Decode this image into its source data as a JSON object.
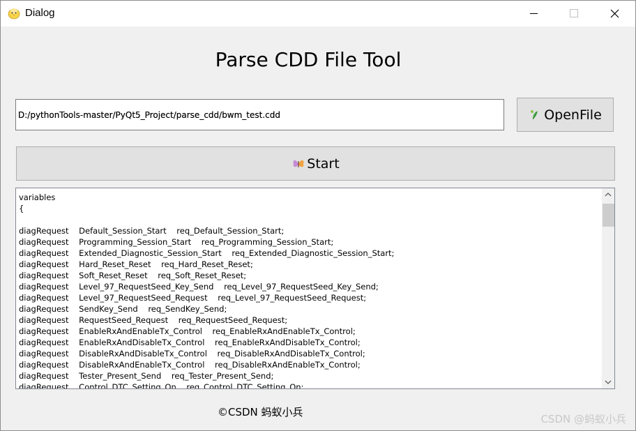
{
  "window": {
    "title": "Dialog",
    "controls": [
      "minimize-icon",
      "maximize-icon",
      "close-icon"
    ]
  },
  "main": {
    "heading": "Parse CDD File Tool",
    "path_value": "D:/pythonTools-master/PyQt5_Project/parse_cdd/bwm_test.cdd",
    "open_button_label": "OpenFile",
    "start_button_label": "Start",
    "output_lines": [
      "variables",
      "{",
      "",
      "diagRequest    Default_Session_Start    req_Default_Session_Start;",
      "diagRequest    Programming_Session_Start    req_Programming_Session_Start;",
      "diagRequest    Extended_Diagnostic_Session_Start    req_Extended_Diagnostic_Session_Start;",
      "diagRequest    Hard_Reset_Reset    req_Hard_Reset_Reset;",
      "diagRequest    Soft_Reset_Reset    req_Soft_Reset_Reset;",
      "diagRequest    Level_97_RequestSeed_Key_Send    req_Level_97_RequestSeed_Key_Send;",
      "diagRequest    Level_97_RequestSeed_Request    req_Level_97_RequestSeed_Request;",
      "diagRequest    SendKey_Send    req_SendKey_Send;",
      "diagRequest    RequestSeed_Request    req_RequestSeed_Request;",
      "diagRequest    EnableRxAndEnableTx_Control    req_EnableRxAndEnableTx_Control;",
      "diagRequest    EnableRxAndDisableTx_Control    req_EnableRxAndDisableTx_Control;",
      "diagRequest    DisableRxAndDisableTx_Control    req_DisableRxAndDisableTx_Control;",
      "diagRequest    DisableRxAndEnableTx_Control    req_DisableRxAndEnableTx_Control;",
      "diagRequest    Tester_Present_Send    req_Tester_Present_Send;",
      "diagRequest    Control_DTC_Setting_On    req_Control_DTC_Setting_On;"
    ]
  },
  "footer": {
    "credit": "©CSDN 蚂蚁小兵",
    "watermark": "CSDN @蚂蚁小兵"
  },
  "icons": {
    "app": "chick-icon",
    "open": "leaf-icon",
    "start": "butterfly-icon",
    "scroll_up": "chevron-up-icon",
    "scroll_down": "chevron-down-icon"
  },
  "colors": {
    "window_bg": "#f0f0f0",
    "button_bg": "#e1e1e1",
    "button_border": "#adadad",
    "scroll_thumb": "#cdcdcd",
    "watermark": "#c8c8c8"
  }
}
